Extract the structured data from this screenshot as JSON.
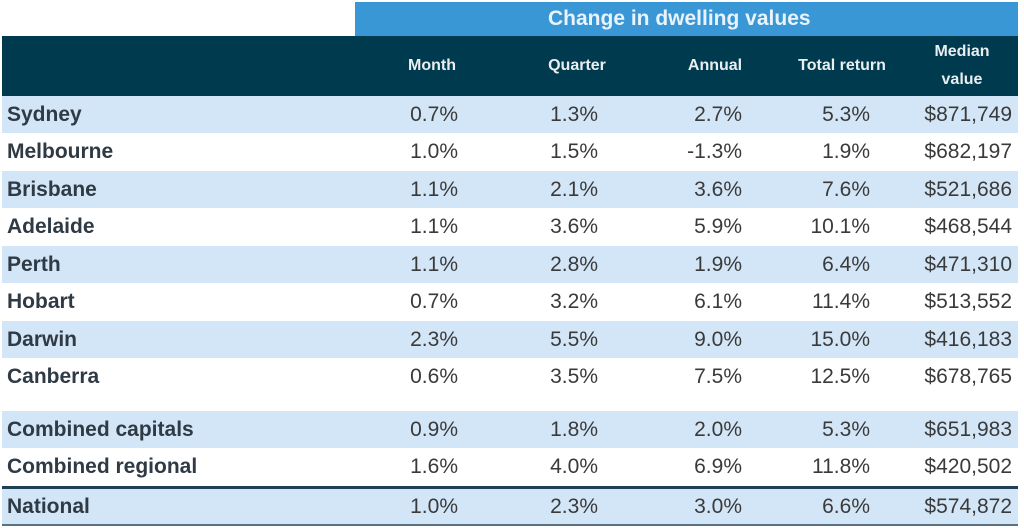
{
  "table": {
    "super_header": "Change in dwelling values",
    "columns": [
      "Month",
      "Quarter",
      "Annual",
      "Total return",
      "Median value"
    ],
    "rows": [
      {
        "name": "Sydney",
        "month": "0.7%",
        "quarter": "1.3%",
        "annual": "2.7%",
        "total_return": "5.3%",
        "median_value": "$871,749"
      },
      {
        "name": "Melbourne",
        "month": "1.0%",
        "quarter": "1.5%",
        "annual": "-1.3%",
        "total_return": "1.9%",
        "median_value": "$682,197"
      },
      {
        "name": "Brisbane",
        "month": "1.1%",
        "quarter": "2.1%",
        "annual": "3.6%",
        "total_return": "7.6%",
        "median_value": "$521,686"
      },
      {
        "name": "Adelaide",
        "month": "1.1%",
        "quarter": "3.6%",
        "annual": "5.9%",
        "total_return": "10.1%",
        "median_value": "$468,544"
      },
      {
        "name": "Perth",
        "month": "1.1%",
        "quarter": "2.8%",
        "annual": "1.9%",
        "total_return": "6.4%",
        "median_value": "$471,310"
      },
      {
        "name": "Hobart",
        "month": "0.7%",
        "quarter": "3.2%",
        "annual": "6.1%",
        "total_return": "11.4%",
        "median_value": "$513,552"
      },
      {
        "name": "Darwin",
        "month": "2.3%",
        "quarter": "5.5%",
        "annual": "9.0%",
        "total_return": "15.0%",
        "median_value": "$416,183"
      },
      {
        "name": "Canberra",
        "month": "0.6%",
        "quarter": "3.5%",
        "annual": "7.5%",
        "total_return": "12.5%",
        "median_value": "$678,765"
      },
      {
        "name": "Combined capitals",
        "month": "0.9%",
        "quarter": "1.8%",
        "annual": "2.0%",
        "total_return": "5.3%",
        "median_value": "$651,983"
      },
      {
        "name": "Combined regional",
        "month": "1.6%",
        "quarter": "4.0%",
        "annual": "6.9%",
        "total_return": "11.8%",
        "median_value": "$420,502"
      },
      {
        "name": "National",
        "month": "1.0%",
        "quarter": "2.3%",
        "annual": "3.0%",
        "total_return": "6.6%",
        "median_value": "$574,872"
      }
    ]
  },
  "colors": {
    "super_header_bg": "#3a97d6",
    "header_bg": "#003a4f",
    "row_shade": "#d3e6f7"
  }
}
